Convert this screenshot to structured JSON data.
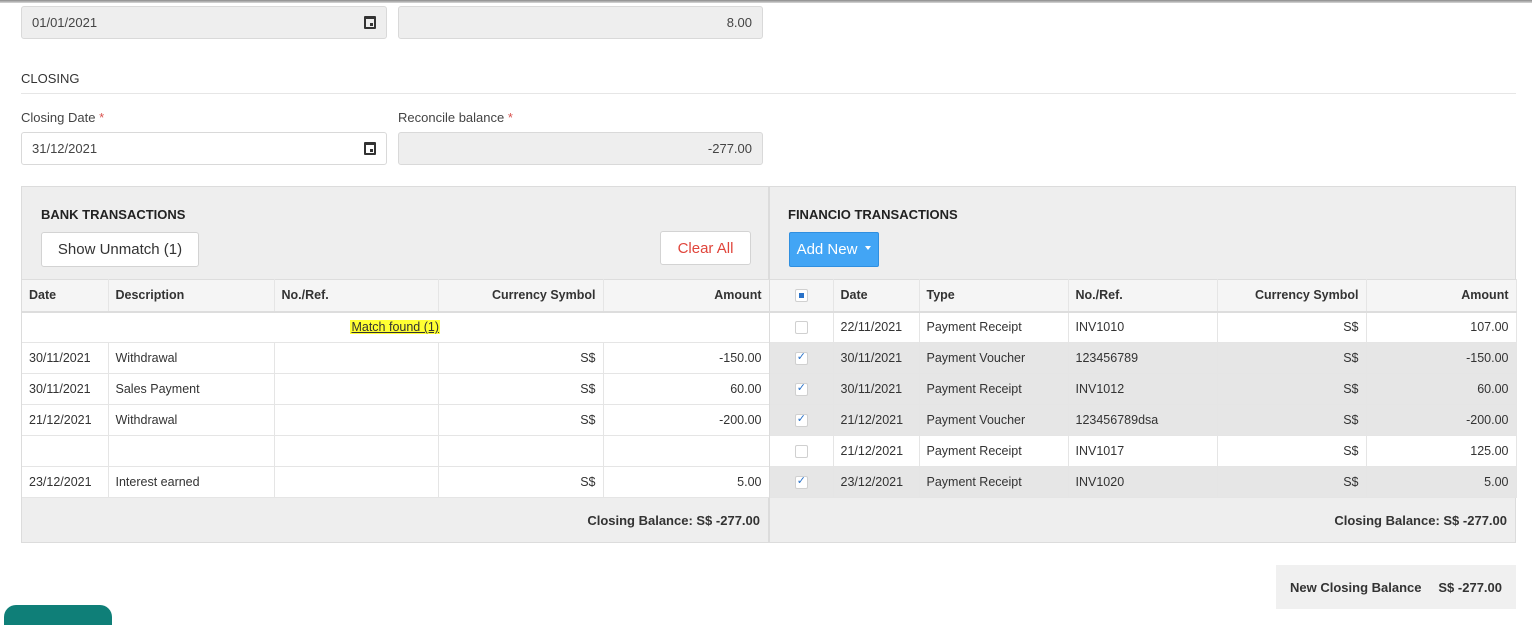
{
  "opening": {
    "date_value": "01/01/2021",
    "balance_value": "8.00"
  },
  "closing": {
    "section_title": "CLOSING",
    "closing_date_label": "Closing Date",
    "closing_date_value": "31/12/2021",
    "reconcile_label": "Reconcile balance",
    "reconcile_value": "-277.00",
    "required_mark": "*"
  },
  "bank": {
    "title": "BANK TRANSACTIONS",
    "show_unmatch_label": "Show Unmatch (1)",
    "clear_all_label": "Clear All",
    "columns": [
      "Date",
      "Description",
      "No./Ref.",
      "Currency Symbol",
      "Amount"
    ],
    "match_found_label": "Match found (1)",
    "rows": [
      {
        "date": "30/11/2021",
        "description": "Withdrawal",
        "ref": "",
        "currency": "S$",
        "amount": "-150.00"
      },
      {
        "date": "30/11/2021",
        "description": "Sales Payment",
        "ref": "",
        "currency": "S$",
        "amount": "60.00"
      },
      {
        "date": "21/12/2021",
        "description": "Withdrawal",
        "ref": "",
        "currency": "S$",
        "amount": "-200.00"
      },
      {
        "date": "",
        "description": "",
        "ref": "",
        "currency": "",
        "amount": ""
      },
      {
        "date": "23/12/2021",
        "description": "Interest earned",
        "ref": "",
        "currency": "S$",
        "amount": "5.00"
      }
    ],
    "closing_balance": "Closing Balance: S$ -277.00"
  },
  "financio": {
    "title": "FINANCIO TRANSACTIONS",
    "add_new_label": "Add New",
    "columns": [
      "Date",
      "Type",
      "No./Ref.",
      "Currency Symbol",
      "Amount"
    ],
    "rows": [
      {
        "checked": false,
        "date": "22/11/2021",
        "type": "Payment Receipt",
        "ref": "INV1010",
        "currency": "S$",
        "amount": "107.00"
      },
      {
        "checked": true,
        "date": "30/11/2021",
        "type": "Payment Voucher",
        "ref": "123456789",
        "currency": "S$",
        "amount": "-150.00"
      },
      {
        "checked": true,
        "date": "30/11/2021",
        "type": "Payment Receipt",
        "ref": "INV1012",
        "currency": "S$",
        "amount": "60.00"
      },
      {
        "checked": true,
        "date": "21/12/2021",
        "type": "Payment Voucher",
        "ref": "123456789dsa",
        "currency": "S$",
        "amount": "-200.00"
      },
      {
        "checked": false,
        "date": "21/12/2021",
        "type": "Payment Receipt",
        "ref": "INV1017",
        "currency": "S$",
        "amount": "125.00"
      },
      {
        "checked": true,
        "date": "23/12/2021",
        "type": "Payment Receipt",
        "ref": "INV1020",
        "currency": "S$",
        "amount": "5.00"
      }
    ],
    "closing_balance": "Closing Balance: S$ -277.00"
  },
  "summary": {
    "new_closing_label": "New Closing Balance",
    "new_closing_value": "S$ -277.00"
  }
}
